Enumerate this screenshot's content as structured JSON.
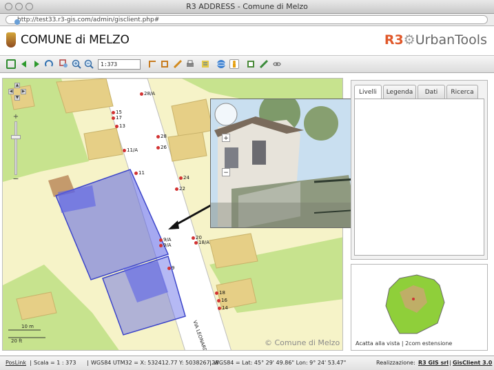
{
  "window": {
    "title": "R3 ADDRESS - Comune di Melzo"
  },
  "urlbar": {
    "url": "http://test33.r3-gis.com/admin/gisclient.php#"
  },
  "header": {
    "site_title": "COMUNE di MELZO",
    "brand_r3": "R3",
    "brand_ut": "UrbanTools"
  },
  "toolbar": {
    "scale_value": "1:373",
    "icons": [
      "zoom-extent-icon",
      "pan-left-icon",
      "pan-right-icon",
      "refresh-icon",
      "zoom-box-icon",
      "zoom-in-icon",
      "zoom-out-icon",
      "select-icon",
      "crop-icon",
      "edit-icon",
      "print-icon",
      "info-icon",
      "globe-icon",
      "street-view-icon",
      "export-icon",
      "tools-icon",
      "link-icon"
    ],
    "accent": "#2e7d32"
  },
  "map": {
    "copyright": "© Comune di Melzo",
    "scalebar_m": "10 m",
    "scalebar_ft": "20 ft",
    "street_label": "VIA LEONARDO DA V",
    "colors": {
      "background": "#f6f3c8",
      "building": "#e6cf86",
      "green": "#c7e38e",
      "road": "#ffffff",
      "selection": "#5b63e6"
    },
    "address_labels": [
      {
        "text": "28/A"
      },
      {
        "text": "15"
      },
      {
        "text": "17"
      },
      {
        "text": "13"
      },
      {
        "text": "28"
      },
      {
        "text": "26"
      },
      {
        "text": "11/A"
      },
      {
        "text": "11"
      },
      {
        "text": "24"
      },
      {
        "text": "22"
      },
      {
        "text": "20"
      },
      {
        "text": "18/A"
      },
      {
        "text": "9/A"
      },
      {
        "text": "9/A"
      },
      {
        "text": "9"
      },
      {
        "text": "18"
      },
      {
        "text": "16"
      },
      {
        "text": "14"
      }
    ]
  },
  "panel": {
    "tabs": [
      {
        "label": "Livelli",
        "active": true
      },
      {
        "label": "Legenda",
        "active": false
      },
      {
        "label": "Dati",
        "active": false
      },
      {
        "label": "Ricerca",
        "active": false
      }
    ]
  },
  "overview": {
    "caption": "Acatta alla vista | 2com estensione"
  },
  "statusbar": {
    "poslink": "PosLink",
    "scale": "Scala = 1 : 373",
    "utm": "WGS84 UTM32 = X: 532412.77 Y: 5038267.28",
    "latlon": "WGS84 = Lat: 45° 29' 49.86\" Lon: 9° 24' 53.47\"",
    "credits_prefix": "Realizzazione:",
    "credits_r3": "R3 GIS srl",
    "credits_sep": "|",
    "credits_gc": "GisClient 3.0"
  }
}
